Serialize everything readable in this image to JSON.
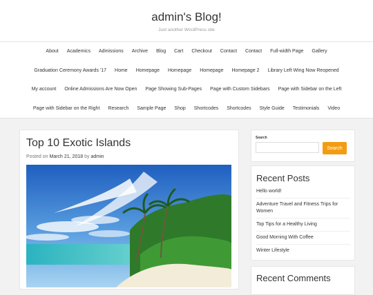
{
  "site": {
    "title": "admin's Blog!",
    "description": "Just another WordPress site"
  },
  "nav": {
    "rows": [
      [
        "About",
        "Academics",
        "Admissions",
        "Archive",
        "Blog",
        "Cart",
        "Checkout",
        "Contact",
        "Contact",
        "Full-width Page",
        "Gallery"
      ],
      [
        "Graduation Ceremony Awards '17",
        "Home",
        "Homepage",
        "Homepage",
        "Homepage",
        "Homepage 2",
        "Library Left Wing Now Reopened"
      ],
      [
        "My account",
        "Online Admissions Are Now Open",
        "Page Showing Sub-Pages",
        "Page with Custom Sidebars",
        "Page with Sidebar on the Left"
      ],
      [
        "Page with Sidebar on the Right",
        "Research",
        "Sample Page",
        "Shop",
        "Shortcodes",
        "Shortcodes",
        "Style Guide",
        "Testimonials",
        "Video"
      ]
    ]
  },
  "post": {
    "title": "Top 10 Exotic Islands",
    "posted_on": "Posted on",
    "date": "March 21, 2018",
    "by": "by",
    "author": "admin"
  },
  "search": {
    "label": "Search",
    "placeholder": "",
    "button": "Search"
  },
  "recent_posts": {
    "title": "Recent Posts",
    "items": [
      "Hello world!",
      "Adventure Travel and Fitness Trips for Women",
      "Top Tips for a Healthy Living",
      "Good Morning With Coffee",
      "Winter Lifestyle"
    ]
  },
  "recent_comments": {
    "title": "Recent Comments"
  },
  "colors": {
    "accent": "#f39c12"
  }
}
